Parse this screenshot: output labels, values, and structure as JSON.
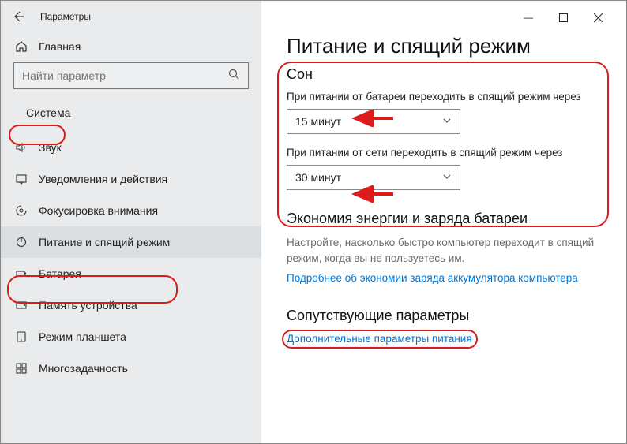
{
  "window": {
    "title": "Параметры",
    "minimize": "—",
    "maximize": "☐",
    "close": "✕",
    "back": "←"
  },
  "sidebar": {
    "home": "Главная",
    "search_placeholder": "Найти параметр",
    "section": "Система",
    "items": [
      {
        "icon": "sound",
        "label": "Звук"
      },
      {
        "icon": "notify",
        "label": "Уведомления и действия"
      },
      {
        "icon": "focus",
        "label": "Фокусировка внимания"
      },
      {
        "icon": "power",
        "label": "Питание и спящий режим",
        "active": true
      },
      {
        "icon": "battery",
        "label": "Батарея"
      },
      {
        "icon": "storage",
        "label": "Память устройства"
      },
      {
        "icon": "tablet",
        "label": "Режим планшета"
      },
      {
        "icon": "multi",
        "label": "Многозадачность"
      }
    ]
  },
  "main": {
    "title": "Питание и спящий режим",
    "sleep": {
      "heading": "Сон",
      "battery_label": "При питании от батареи переходить в спящий режим через",
      "battery_value": "15 минут",
      "ac_label": "При питании от сети переходить в спящий режим через",
      "ac_value": "30 минут"
    },
    "economy": {
      "heading": "Экономия энергии и заряда батареи",
      "desc": "Настройте, насколько быстро компьютер переходит в спящий режим, когда вы не пользуетесь им.",
      "link": "Подробнее об экономии заряда аккумулятора компьютера"
    },
    "related": {
      "heading": "Сопутствующие параметры",
      "link": "Дополнительные параметры питания"
    }
  }
}
